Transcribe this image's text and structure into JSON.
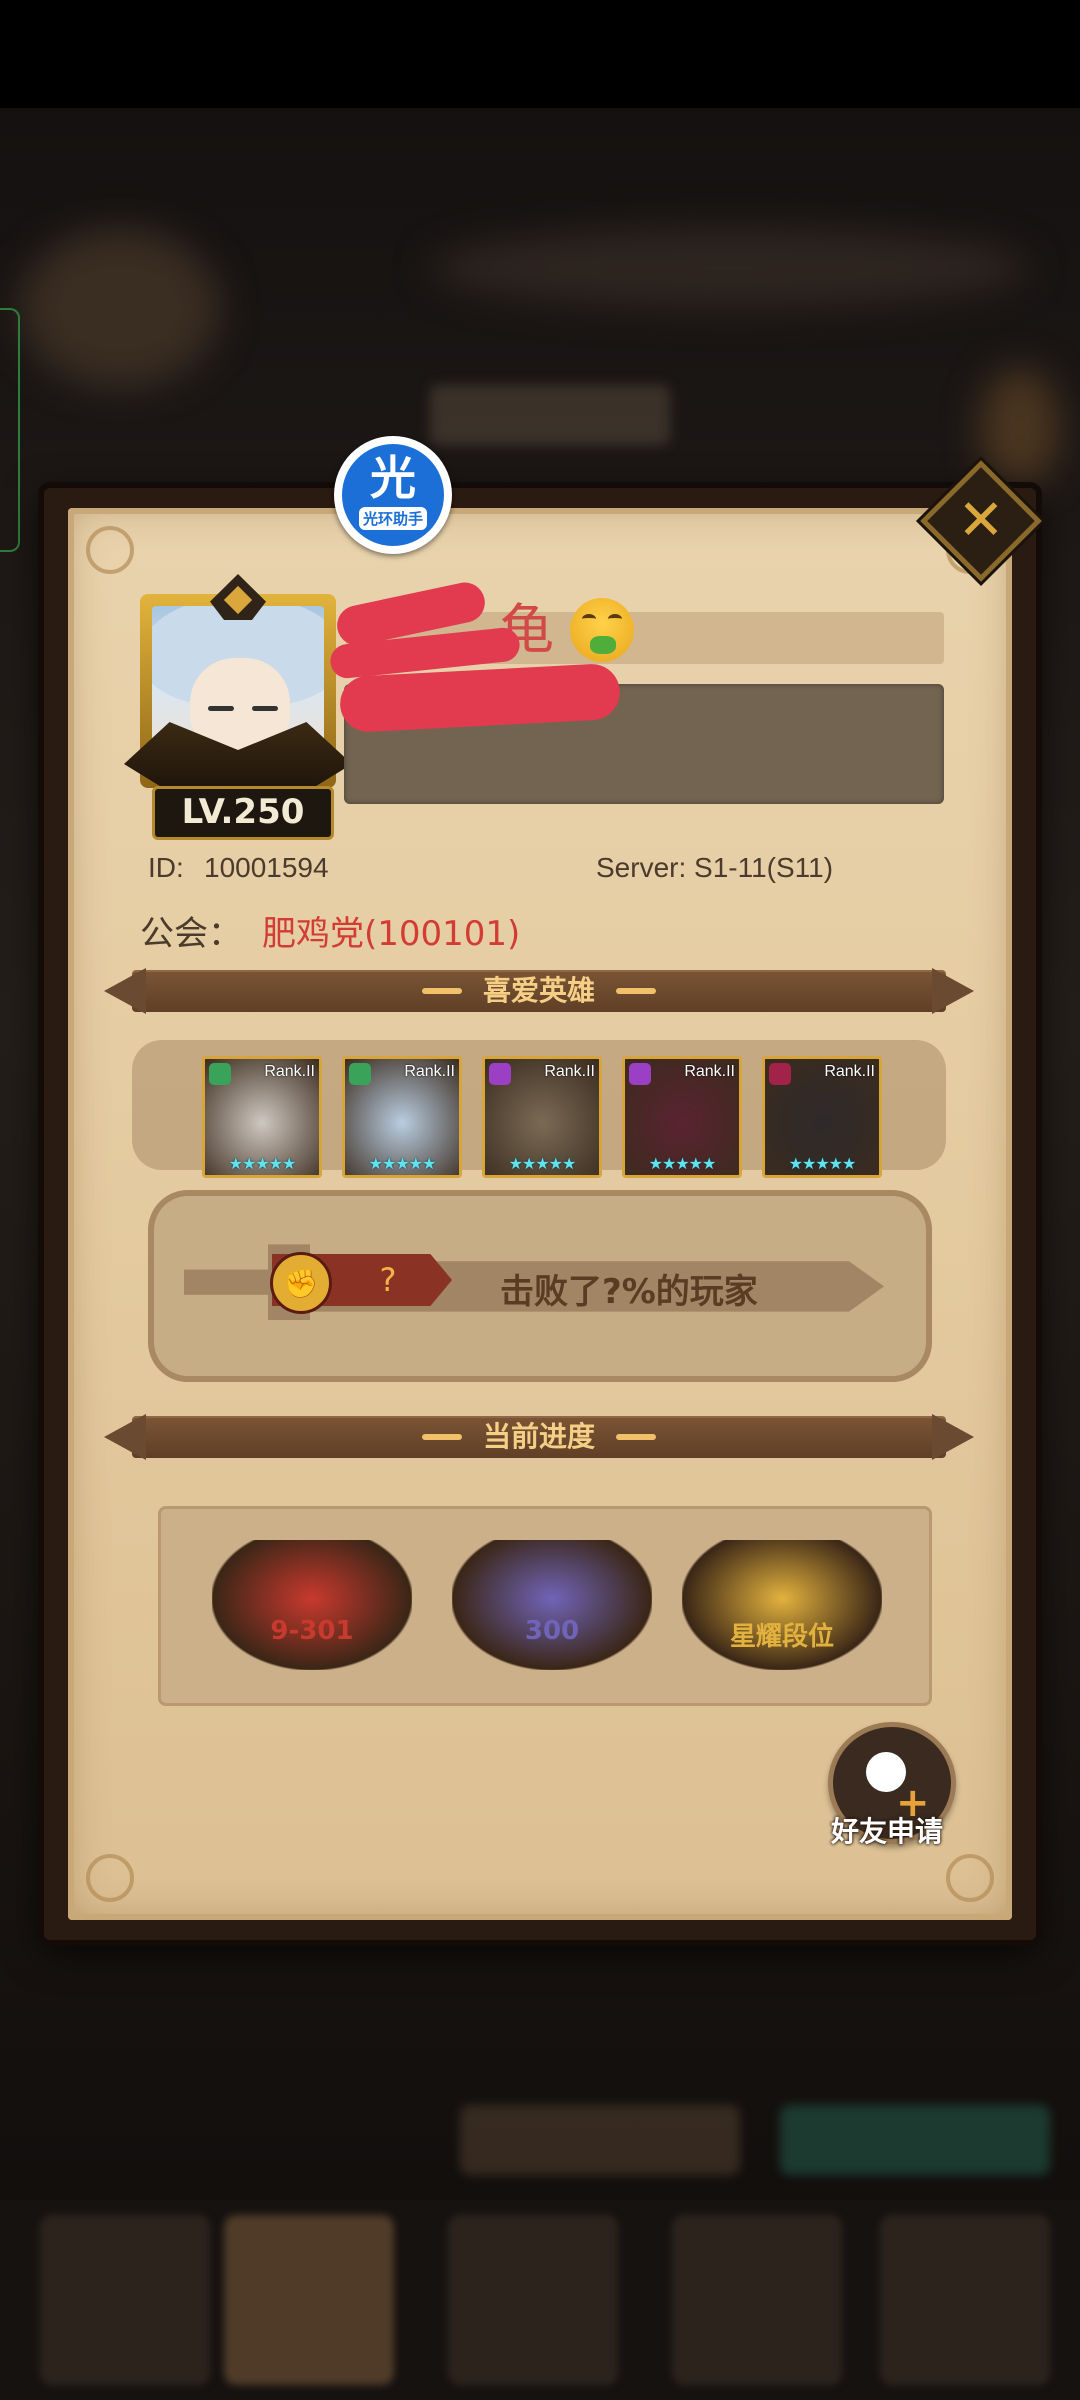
{
  "badge": {
    "char": "光",
    "label": "光环助手"
  },
  "player": {
    "name_suffix": "龟",
    "level": "LV.250",
    "id_label": "ID:",
    "id_value": "10001594",
    "server": "Server: S1-11(S11)",
    "guild_label": "公会：",
    "guild_value": "肥鸡党(100101)"
  },
  "sections": {
    "favorite_heroes": "喜爱英雄",
    "current_progress": "当前进度"
  },
  "heroes": [
    {
      "rank": "Rank.II",
      "stars": "★★★★★",
      "class_color": "#3aa35a",
      "art": "#cfc8c0"
    },
    {
      "rank": "Rank.II",
      "stars": "★★★★★",
      "class_color": "#3aa35a",
      "art": "#b9cde0"
    },
    {
      "rank": "Rank.II",
      "stars": "★★★★★",
      "class_color": "#9b3fc4",
      "art": "#7a6a55"
    },
    {
      "rank": "Rank.II",
      "stars": "★★★★★",
      "class_color": "#9b3fc4",
      "art": "#5a2330"
    },
    {
      "rank": "Rank.II",
      "stars": "★★★★★",
      "class_color": "#a2224a",
      "art": "#2e2a2a"
    }
  ],
  "defeat": {
    "rank_value": "?",
    "text": "击败了?%的玩家"
  },
  "progress": [
    {
      "label": "9-301",
      "color": "#c8392e",
      "icon": "book-icon"
    },
    {
      "label": "300",
      "color": "#7064b8",
      "icon": "tower-icon"
    },
    {
      "label": "星耀段位",
      "color": "#e3b23e",
      "icon": "arena-icon"
    }
  ],
  "friend_request": "好友申请",
  "colors": {
    "accent": "#d9a73c",
    "ribbon": "#6a4a30",
    "guild": "#d23c34"
  }
}
